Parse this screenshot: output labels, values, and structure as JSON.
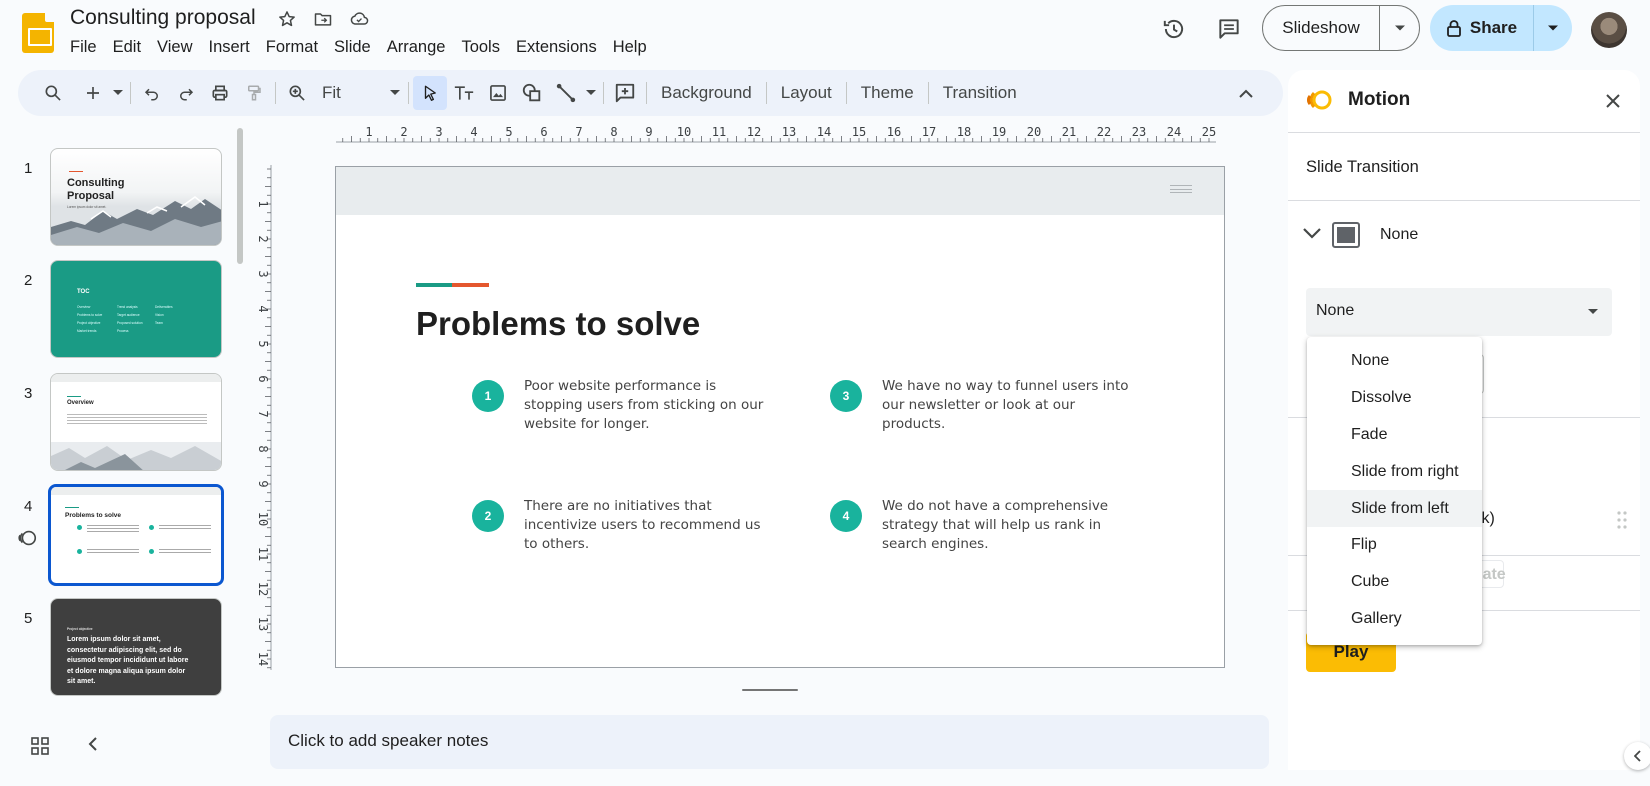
{
  "app": {
    "doc_title": "Consulting proposal",
    "menu": [
      "File",
      "Edit",
      "View",
      "Insert",
      "Format",
      "Slide",
      "Arrange",
      "Tools",
      "Extensions",
      "Help"
    ],
    "slideshow_label": "Slideshow",
    "share_label": "Share"
  },
  "toolbar": {
    "zoom_value": "Fit",
    "background_label": "Background",
    "layout_label": "Layout",
    "theme_label": "Theme",
    "transition_label": "Transition"
  },
  "filmstrip": {
    "slides": [
      {
        "number": "1",
        "title": "Consulting Proposal",
        "subtitle": "Lorem ipsum dolor sit amet."
      },
      {
        "number": "2",
        "title": "TOC",
        "items": [
          "Overview",
          "Problems to solve",
          "Project objective",
          "Market trends",
          "Trend analysis",
          "Target audience",
          "Proposed solution",
          "Process",
          "Deliverables",
          "Vision",
          "Team"
        ]
      },
      {
        "number": "3",
        "title": "Overview"
      },
      {
        "number": "4",
        "title": "Problems to solve"
      },
      {
        "number": "5",
        "label": "Project objective",
        "body": "Lorem ipsum dolor sit amet, consectetur adipiscing elit, sed do eiusmod tempor incididunt ut labore et dolore magna aliqua ipsum dolor sit amet."
      }
    ]
  },
  "slide": {
    "title": "Problems to solve",
    "problems": [
      {
        "num": "1",
        "text": "Poor website performance is stopping users from sticking on our website for longer."
      },
      {
        "num": "3",
        "text": "We have no way to funnel users into our newsletter or look at our products."
      },
      {
        "num": "2",
        "text": "There are no initiatives that incentivize users to recommend us to others."
      },
      {
        "num": "4",
        "text": "We do not have a comprehensive strategy that will help us rank in search engines."
      }
    ],
    "accent_colors": [
      "#1a9b85",
      "#e4572e"
    ],
    "circle_color": "#19b39d"
  },
  "ruler": {
    "horizontal": [
      "1",
      "2",
      "3",
      "4",
      "5",
      "6",
      "7",
      "8",
      "9",
      "10",
      "11",
      "12",
      "13",
      "14",
      "15",
      "16",
      "17",
      "18",
      "19",
      "20",
      "21",
      "22",
      "23",
      "24",
      "25"
    ],
    "vertical": [
      "1",
      "2",
      "3",
      "4",
      "5",
      "6",
      "7",
      "8",
      "9",
      "10",
      "11",
      "12",
      "13",
      "14"
    ]
  },
  "notes": {
    "placeholder": "Click to add speaker notes"
  },
  "motion_panel": {
    "title": "Motion",
    "section_label": "Slide Transition",
    "current_transition": "None",
    "select_value": "None",
    "obscured_text_1": "ick)",
    "obscured_text_2": "o animate",
    "play_label": "Play",
    "accent_color": "#fbbc04"
  },
  "dropdown": {
    "options": [
      "None",
      "Dissolve",
      "Fade",
      "Slide from right",
      "Slide from left",
      "Flip",
      "Cube",
      "Gallery"
    ],
    "hovered": "Slide from left"
  },
  "colors": {
    "selection": "#0b57d0",
    "share_bg": "#c2e7ff",
    "toolbar_bg": "#edf2fa"
  }
}
